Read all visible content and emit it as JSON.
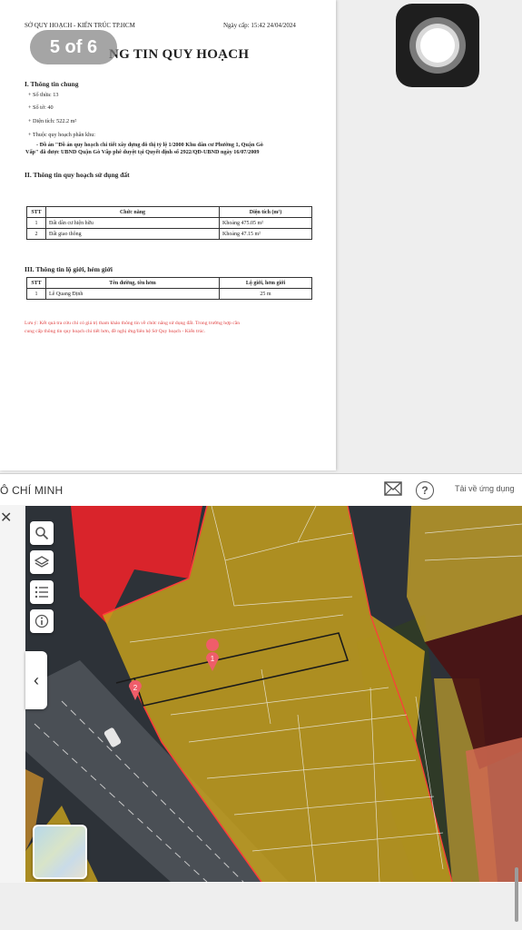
{
  "document": {
    "agency": "SỞ QUY HOẠCH - KIẾN TRÚC TP.HCM",
    "issue_date": "Ngày cấp: 15:42 24/04/2024",
    "title": "NG TIN QUY HOẠCH",
    "section1": {
      "heading": "I. Thông tin chung",
      "items": [
        "+ Số thửa: 13",
        "+ Số tờ: 40",
        "+ Diện tích: 522.2 m²",
        "+ Thuộc quy hoạch phân khu:"
      ],
      "plan_text_1": "- Đồ án \"Đồ án quy hoạch chi tiết xây dựng đô thị tỷ lệ 1/2000 Khu dân cư Phường 1, Quận Gò",
      "plan_text_2": "Vấp\" đã được UBND Quận Gò Vấp phê duyệt tại Quyết định số 2922/QĐ-UBND ngày 16/07/2009"
    },
    "section2": {
      "heading": "II. Thông tin quy hoạch sử dụng đất",
      "columns": [
        "STT",
        "Chức năng",
        "Diện tích (m²)"
      ],
      "rows": [
        [
          "1",
          "Đất dân cư hiện hữu",
          "Khoảng 475.05 m²"
        ],
        [
          "2",
          "Đất giao thông",
          "Khoảng 47.15 m²"
        ]
      ]
    },
    "section3": {
      "heading": "III. Thông tin lộ giới, hẻm giới",
      "columns": [
        "STT",
        "Tên đường, tên hẻm",
        "Lộ giới, hẻm giới"
      ],
      "rows": [
        [
          "1",
          "Lê Quang Định",
          "25 m"
        ]
      ]
    },
    "note_1": "Lưu ý: Kết quả tra cứu chỉ có giá trị tham khảo thông tin về chức năng sử dụng đất. Trong trường hợp cần",
    "note_2": "cung cấp thông tin quy hoạch chi tiết hơn, đề nghị ứng/liên hệ Sở Quy hoạch - Kiến trúc."
  },
  "page_indicator": "5 of 6",
  "app": {
    "title": "Ô CHÍ MINH",
    "download_label": "Tải về ứng dụng",
    "help_label": "?",
    "close_label": "✕",
    "collapse_label": "‹",
    "tools": [
      "search-icon",
      "layers-icon",
      "list-icon",
      "info-icon"
    ],
    "markers": [
      "1",
      "2"
    ]
  },
  "colors": {
    "residential_zone": "#c9a21c",
    "commercial_zone": "#e8232a",
    "dark_zone": "#4a1414",
    "parcel_outline": "#222222",
    "note_red": "#e04040"
  }
}
